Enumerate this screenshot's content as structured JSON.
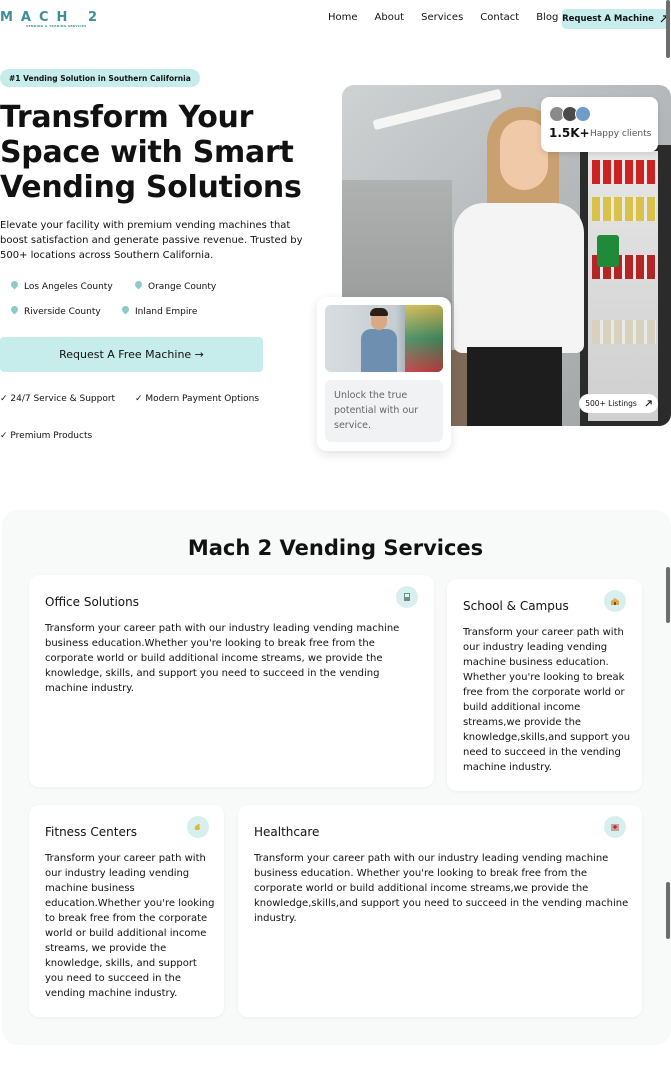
{
  "nav": {
    "logo_text": "MACH 2",
    "logo_sub": "VENDING & TRADING SERVICES",
    "links": [
      "Home",
      "About",
      "Services",
      "Contact",
      "Blog"
    ],
    "cta_label": "Request A Machine",
    "cta_icon": "arrow-up-right-icon"
  },
  "hero": {
    "badge": "#1 Vending Solution in Southern California",
    "title": "Transform Your Space with Smart Vending Solutions",
    "description": "Elevate your facility with premium vending machines that boost satisfaction and generate passive revenue. Trusted by 500+ locations across Southern California.",
    "counties": [
      "Los Angeles County",
      "Orange County",
      "Riverside County",
      "Inland Empire"
    ],
    "cta_label": "Request A Free Machine →",
    "features": [
      "✓ 24/7 Service & Support",
      "✓ Modern Payment Options",
      "✓ Premium Products"
    ],
    "clients_count": "1.5K+",
    "clients_label": "Happy clients",
    "listings_label": "500+ Listings",
    "mini_card_text": "Unlock the true potential with our service."
  },
  "services": {
    "title": "Mach 2 Vending Services",
    "cards": [
      {
        "title": "Office Solutions",
        "icon": "vending-icon",
        "text": "Transform your career path with our industry leading vending machine business education.Whether you're looking to break free from the corporate world or build additional income streams, we provide the knowledge, skills, and support you need to succeed in the vending machine industry."
      },
      {
        "title": "School & Campus",
        "icon": "school-icon",
        "text": "Transform your career path with our industry leading vending machine business education. Whether you're looking to break free from the corporate world or build additional income streams,we provide the knowledge,skills,and support you need to succeed in the vending machine industry."
      },
      {
        "title": "Fitness Centers",
        "icon": "muscle-icon",
        "text": "Transform your career path with our industry leading vending machine business education.Whether you're looking to break free from the corporate world or build additional income streams, we provide the knowledge, skills, and support you need to succeed in the vending machine industry."
      },
      {
        "title": "Healthcare",
        "icon": "hospital-icon",
        "text": "Transform your career path with our industry leading vending machine business education. Whether you're looking to break free from the corporate world or build additional income streams,we provide the knowledge,skills,and support you need to succeed in the vending machine industry."
      }
    ]
  },
  "colors": {
    "accent": "#c6ecec",
    "brand": "#3b8f99",
    "text": "#111111"
  }
}
